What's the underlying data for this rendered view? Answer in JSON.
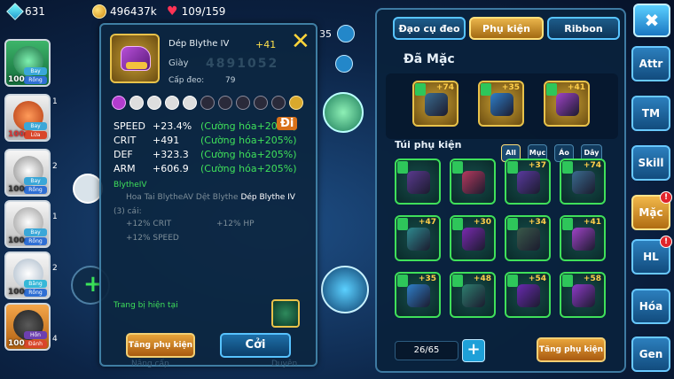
{
  "currency": {
    "gems": "631",
    "gold": "496437k",
    "energy": "109/159"
  },
  "pets": [
    {
      "level": "100",
      "types": [
        "Bay",
        "Rồng"
      ],
      "badge": ""
    },
    {
      "level": "100",
      "types": [
        "Bay",
        "Lửa"
      ],
      "badge": "1"
    },
    {
      "level": "100",
      "types": [
        "Bay",
        "Rồng"
      ],
      "badge": "2"
    },
    {
      "level": "100",
      "types": [
        "Bay",
        "Rồng"
      ],
      "badge": "1"
    },
    {
      "level": "100",
      "types": [
        "Băng",
        "Rồng"
      ],
      "badge": "2"
    },
    {
      "level": "100",
      "types": [
        "Hồn",
        "Đánh"
      ],
      "badge": "4"
    }
  ],
  "left_labels": {
    "counter_35": "35",
    "go_label": "Đi"
  },
  "tooltip": {
    "name": "Dép Blythe IV",
    "plus": "+41",
    "slot_type": "Giày",
    "code": "4891052",
    "req_label": "Cấp đeo:",
    "req_value": "79",
    "stats": [
      {
        "key": "SPEED",
        "value": "+23.4%",
        "enh": "(Cường hóa+205%)"
      },
      {
        "key": "CRIT",
        "value": "+491",
        "enh": "(Cường hóa+205%)"
      },
      {
        "key": "DEF",
        "value": "+323.3",
        "enh": "(Cường hóa+205%)"
      },
      {
        "key": "ARM",
        "value": "+606.9",
        "enh": "(Cường hóa+205%)"
      }
    ],
    "set_name": "BlytheIV",
    "set_item_1": "Hoa Tai BlytheAV",
    "set_item_2": "Dệt Blythe",
    "set_item_3": "Dép Blythe IV",
    "set_count": "(3) cái:",
    "set_bonus_1": "+12% CRIT",
    "set_bonus_2": "+12% HP",
    "set_bonus_3": "+12% SPEED",
    "current_label": "Trang bị hiện tại",
    "btn_upgrade": "Tăng phụ kiện",
    "btn_remove": "Cởi",
    "ghost_text_1": "Nâng cấp",
    "ghost_text_2": "Duyên"
  },
  "panel": {
    "tabs": [
      "Đạo cụ đeo",
      "Phụ kiện",
      "Ribbon"
    ],
    "equipped_title": "Đã Mặc",
    "equipped": [
      {
        "plus": "+74",
        "color": "#3a6b8f"
      },
      {
        "plus": "+35",
        "color": "#2f7fc9"
      },
      {
        "plus": "+41",
        "color": "#a043c7"
      }
    ],
    "bag_title": "Túi phụ kiện",
    "filters": [
      "All",
      "Mục",
      "Áo",
      "Dây"
    ],
    "bag": [
      {
        "plus": "",
        "color": "#5a3a8f"
      },
      {
        "plus": "",
        "color": "#b63a5e"
      },
      {
        "plus": "+37",
        "color": "#5a3a9f"
      },
      {
        "plus": "+74",
        "color": "#3a6b8f"
      },
      {
        "plus": "+47",
        "color": "#2e8a8f"
      },
      {
        "plus": "+30",
        "color": "#7a2ab0"
      },
      {
        "plus": "+34",
        "color": "#3a5a4a"
      },
      {
        "plus": "+41",
        "color": "#a043c7"
      },
      {
        "plus": "+35",
        "color": "#2f7fc9"
      },
      {
        "plus": "+48",
        "color": "#2e7f6f"
      },
      {
        "plus": "+54",
        "color": "#6a2ab0"
      },
      {
        "plus": "+58",
        "color": "#8f3ac7"
      }
    ],
    "count": "26/65",
    "add_label": "+",
    "btn_upgrade": "Tăng phụ kiện"
  },
  "side_menu": [
    {
      "label": "Attr",
      "alert": false
    },
    {
      "label": "TM",
      "alert": false
    },
    {
      "label": "Skill",
      "alert": false
    },
    {
      "label": "Mặc",
      "alert": true,
      "active": true
    },
    {
      "label": "HL",
      "alert": true
    },
    {
      "label": "Hóa",
      "alert": false
    },
    {
      "label": "Gen",
      "alert": false
    }
  ],
  "close_icon_label": "✖"
}
